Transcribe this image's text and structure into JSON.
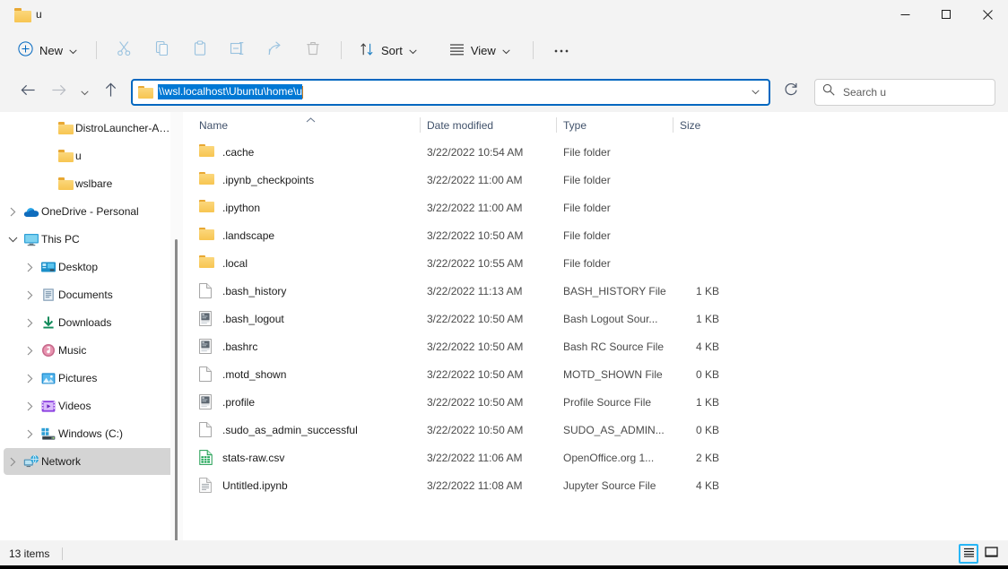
{
  "window": {
    "tab_title": "u",
    "tab_icon": "folder-icon",
    "minimize_label": "—",
    "maximize_label": "☐",
    "close_label": "✕"
  },
  "toolbar": {
    "new_label": "New",
    "new_icon": "plus-circle-icon",
    "items": [
      {
        "name": "cut-button",
        "icon": "scissors-icon",
        "disabled": true
      },
      {
        "name": "copy-button",
        "icon": "copy-icon",
        "disabled": true
      },
      {
        "name": "paste-button",
        "icon": "clipboard-icon",
        "disabled": true
      },
      {
        "name": "rename-button",
        "icon": "rename-icon",
        "disabled": true
      },
      {
        "name": "share-button",
        "icon": "share-icon",
        "disabled": true
      },
      {
        "name": "delete-button",
        "icon": "trash-icon",
        "disabled": true
      }
    ],
    "sort_label": "Sort",
    "sort_icon": "sort-arrows-icon",
    "view_label": "View",
    "view_icon": "list-lines-icon",
    "more_label": "•••",
    "more_icon": "ellipsis-icon"
  },
  "address": {
    "back_icon": "arrow-left-icon",
    "forward_icon": "arrow-right-icon",
    "recent_icon": "chevron-down-icon",
    "up_icon": "arrow-up-icon",
    "folder_icon": "folder-icon",
    "path": "\\\\wsl.localhost\\Ubuntu\\home\\u",
    "path_selected": true,
    "dropdown_icon": "chevron-down-icon",
    "refresh_icon": "refresh-icon",
    "refresh_label": "Refresh"
  },
  "search": {
    "icon": "search-icon",
    "placeholder": "Search u",
    "value": ""
  },
  "sidebar": {
    "items": [
      {
        "label": "DistroLauncher-Appx",
        "icon": "folder-icon",
        "indent": 2,
        "expander": "none",
        "selected": false
      },
      {
        "label": "u",
        "icon": "folder-icon",
        "indent": 2,
        "expander": "none",
        "selected": false
      },
      {
        "label": "wslbare",
        "icon": "folder-icon",
        "indent": 2,
        "expander": "none",
        "selected": false
      },
      {
        "label": "OneDrive - Personal",
        "icon": "onedrive-cloud-icon",
        "indent": 0,
        "expander": "collapsed",
        "selected": false
      },
      {
        "label": "This PC",
        "icon": "this-pc-monitor-icon",
        "indent": 0,
        "expander": "expanded",
        "selected": false
      },
      {
        "label": "Desktop",
        "icon": "desktop-icon",
        "indent": 1,
        "expander": "collapsed",
        "selected": false
      },
      {
        "label": "Documents",
        "icon": "documents-icon",
        "indent": 1,
        "expander": "collapsed",
        "selected": false
      },
      {
        "label": "Downloads",
        "icon": "downloads-icon",
        "indent": 1,
        "expander": "collapsed",
        "selected": false
      },
      {
        "label": "Music",
        "icon": "music-icon",
        "indent": 1,
        "expander": "collapsed",
        "selected": false
      },
      {
        "label": "Pictures",
        "icon": "pictures-icon",
        "indent": 1,
        "expander": "collapsed",
        "selected": false
      },
      {
        "label": "Videos",
        "icon": "videos-icon",
        "indent": 1,
        "expander": "collapsed",
        "selected": false
      },
      {
        "label": "Windows (C:)",
        "icon": "drive-windows-icon",
        "indent": 1,
        "expander": "collapsed",
        "selected": false
      },
      {
        "label": "Network",
        "icon": "network-icon",
        "indent": 0,
        "expander": "collapsed",
        "selected": true
      }
    ]
  },
  "filelist": {
    "columns": [
      {
        "key": "name",
        "label": "Name",
        "sorted": "asc"
      },
      {
        "key": "date",
        "label": "Date modified",
        "sorted": "none"
      },
      {
        "key": "type",
        "label": "Type",
        "sorted": "none"
      },
      {
        "key": "size",
        "label": "Size",
        "sorted": "none"
      }
    ],
    "rows": [
      {
        "name": ".cache",
        "date": "3/22/2022 10:54 AM",
        "type": "File folder",
        "size": "",
        "icon": "folder-icon"
      },
      {
        "name": ".ipynb_checkpoints",
        "date": "3/22/2022 11:00 AM",
        "type": "File folder",
        "size": "",
        "icon": "folder-icon"
      },
      {
        "name": ".ipython",
        "date": "3/22/2022 11:00 AM",
        "type": "File folder",
        "size": "",
        "icon": "folder-icon"
      },
      {
        "name": ".landscape",
        "date": "3/22/2022 10:50 AM",
        "type": "File folder",
        "size": "",
        "icon": "folder-icon"
      },
      {
        "name": ".local",
        "date": "3/22/2022 10:55 AM",
        "type": "File folder",
        "size": "",
        "icon": "folder-icon"
      },
      {
        "name": ".bash_history",
        "date": "3/22/2022 11:13 AM",
        "type": "BASH_HISTORY File",
        "size": "1 KB",
        "icon": "blank-file-icon"
      },
      {
        "name": ".bash_logout",
        "date": "3/22/2022 10:50 AM",
        "type": "Bash Logout Sour...",
        "size": "1 KB",
        "icon": "script-file-icon"
      },
      {
        "name": ".bashrc",
        "date": "3/22/2022 10:50 AM",
        "type": "Bash RC Source File",
        "size": "4 KB",
        "icon": "script-file-icon"
      },
      {
        "name": ".motd_shown",
        "date": "3/22/2022 10:50 AM",
        "type": "MOTD_SHOWN File",
        "size": "0 KB",
        "icon": "blank-file-icon"
      },
      {
        "name": ".profile",
        "date": "3/22/2022 10:50 AM",
        "type": "Profile Source File",
        "size": "1 KB",
        "icon": "script-file-icon"
      },
      {
        "name": ".sudo_as_admin_successful",
        "date": "3/22/2022 10:50 AM",
        "type": "SUDO_AS_ADMIN...",
        "size": "0 KB",
        "icon": "blank-file-icon"
      },
      {
        "name": "stats-raw.csv",
        "date": "3/22/2022 11:06 AM",
        "type": "OpenOffice.org 1...",
        "size": "2 KB",
        "icon": "spreadsheet-file-icon"
      },
      {
        "name": "Untitled.ipynb",
        "date": "3/22/2022 11:08 AM",
        "type": "Jupyter Source File",
        "size": "4 KB",
        "icon": "text-file-icon"
      }
    ]
  },
  "statusbar": {
    "item_count": "13 items",
    "details_view_icon": "details-view-icon",
    "pane_view_icon": "preview-pane-icon",
    "active_view": "details-view-icon"
  },
  "colors": {
    "accent": "#0078d4",
    "address_border": "#0067c0",
    "selection_bg": "#0078d4",
    "nav_selected_bg": "#d4d4d4",
    "toggle_active": "#29b6f6",
    "header_text": "#41526b",
    "chrome_bg": "#f3f3f3",
    "folder_yellow": "#f7c551"
  }
}
